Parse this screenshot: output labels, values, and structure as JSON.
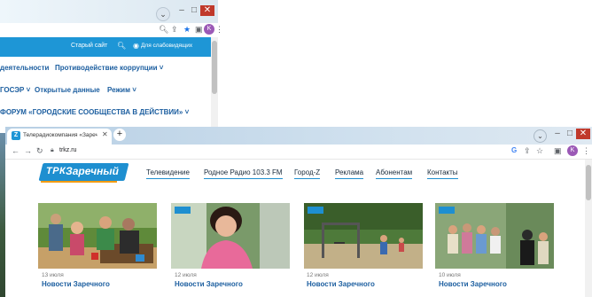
{
  "back_window": {
    "old_site": "Старый сайт",
    "accessible": "Для слабовидящих",
    "nav": [
      "деятельности",
      "Противодействие коррупции ˅",
      "ГОСЭР ˅",
      "Открытые данные",
      "Режим ˅",
      "ФОРУМ «ГОРОДСКИЕ СООБЩЕСТВА В ДЕЙСТВИИ» ˅"
    ],
    "avatar": "K"
  },
  "front_window": {
    "tab_title": "Телерадиокомпания «Заречный»",
    "url": "trkz.ru",
    "avatar": "K",
    "logo_prefix": "ТРК",
    "logo_name": "Заречный",
    "menu": [
      "Телевидение",
      "Родное Радио 103.3 FM",
      "Город-Z",
      "Реклама",
      "Абонентам",
      "Контакты"
    ],
    "news": [
      {
        "date": "13 июля",
        "title": "Новости Заречного"
      },
      {
        "date": "12 июля",
        "title": "Новости Заречного"
      },
      {
        "date": "12 июля",
        "title": "Новости Заречного"
      },
      {
        "date": "10 июля",
        "title": "Новости Заречного"
      }
    ]
  },
  "colors": {
    "accent": "#1e96d6",
    "link": "#1d5fa0",
    "close": "#c0392b",
    "avatar": "#9b59b6"
  },
  "icons": [
    "search-icon",
    "star-icon",
    "share-icon",
    "menu-icon",
    "back-icon",
    "forward-icon",
    "reload-icon",
    "lock-icon"
  ]
}
